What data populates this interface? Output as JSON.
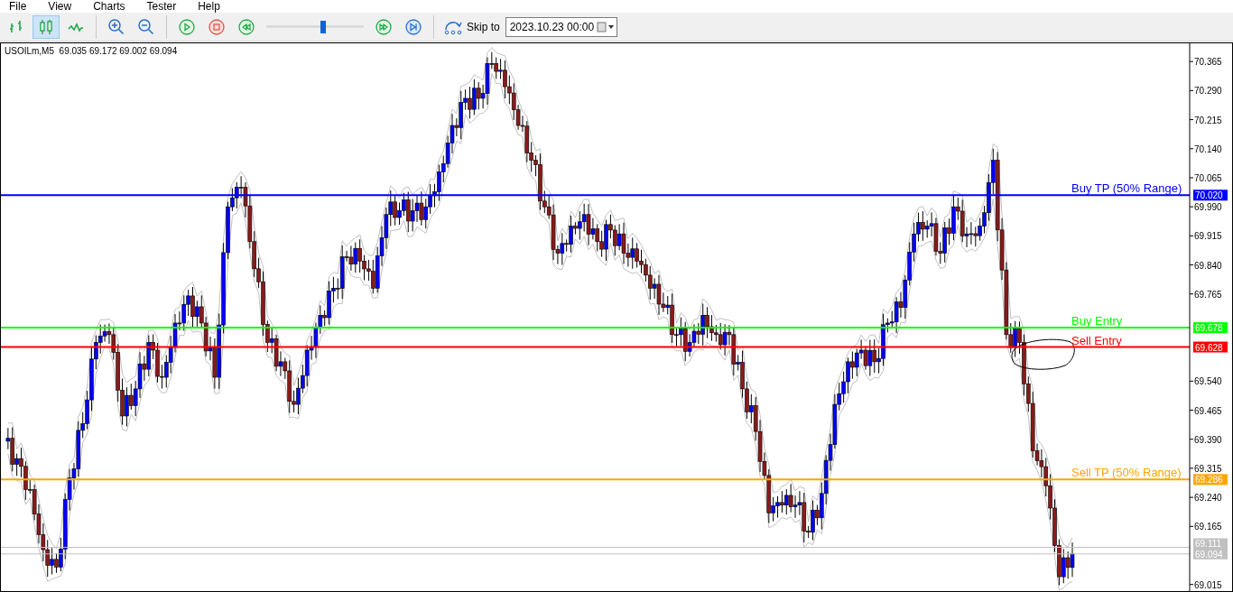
{
  "menu": [
    "File",
    "View",
    "Charts",
    "Tester",
    "Help"
  ],
  "toolbar": {
    "buttons": [
      {
        "kind": "bar-chart",
        "selected": false
      },
      {
        "kind": "candle-chart",
        "selected": true
      },
      {
        "kind": "line-chart",
        "selected": false
      },
      {
        "kind": "zoom-in",
        "selected": false
      },
      {
        "kind": "zoom-out",
        "selected": false
      },
      {
        "kind": "play",
        "selected": false
      },
      {
        "kind": "stop",
        "selected": false
      },
      {
        "kind": "rewind",
        "selected": false
      }
    ],
    "speed": {
      "level": 0.58
    },
    "buttons2": [
      {
        "kind": "fast-forward",
        "selected": false
      },
      {
        "kind": "skip-end",
        "selected": false
      }
    ],
    "skip_to": "Skip to",
    "date": "2023.10.23 00:00"
  },
  "chart": {
    "header": "USOILm,M5  69.035 69.172 69.002 69.094",
    "levels": [
      {
        "label": "Buy TP (50% Range)",
        "price": "70.020",
        "color": "#0000ff"
      },
      {
        "label": "Buy Entry",
        "price": "69.678",
        "color": "#00ff00"
      },
      {
        "label": "Sell Entry",
        "price": "69.628",
        "color": "#ff0000"
      },
      {
        "label": "Sell TP (50% Range)",
        "price": "69.286",
        "color": "#ffa500"
      },
      {
        "price": "69.111",
        "color": "#c0c0c0"
      },
      {
        "price": "69.094",
        "color": "#c0c0c0"
      }
    ],
    "price_axis": [
      "70.365",
      "70.290",
      "70.215",
      "70.140",
      "70.065",
      "69.990",
      "69.915",
      "69.840",
      "69.765",
      "69.540",
      "69.465",
      "69.390",
      "69.315",
      "69.240",
      "69.165",
      "69.015"
    ]
  }
}
